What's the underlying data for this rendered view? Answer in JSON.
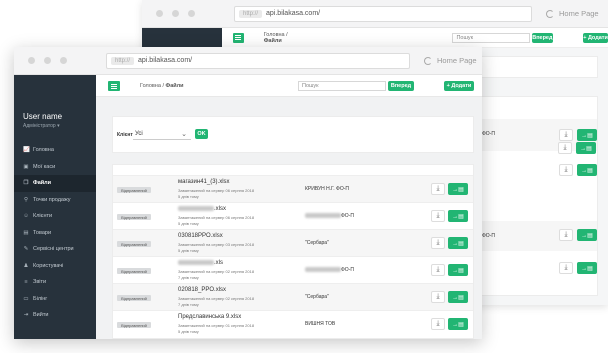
{
  "back_window": {
    "url": "api.bilakasa.com/",
    "url_prefix": "http://",
    "home_label": "Home Page",
    "breadcrumb_home": "Головна",
    "breadcrumb_sep": "/",
    "breadcrumb_current": "Файли",
    "search_placeholder": "Пошук",
    "search_button": "Вперед",
    "add_button": "+ Додати",
    "rows": [
      {
        "client_suffix": "ФО-П"
      },
      {
        "client_suffix": ""
      },
      {
        "client_suffix": "ФО-П"
      },
      {
        "client_suffix": ""
      },
      {
        "client_suffix": ""
      }
    ]
  },
  "front_window": {
    "url_prefix": "http://",
    "url": "api.bilakasa.com/",
    "home_label": "Home Page",
    "user": {
      "name": "User name",
      "role": "Адміністратор ▾"
    },
    "sidebar": {
      "items": [
        {
          "icon": "chart-icon",
          "glyph": "📈",
          "label": "Головна",
          "active": false
        },
        {
          "icon": "cart-icon",
          "glyph": "▣",
          "label": "Мої каси",
          "active": false
        },
        {
          "icon": "files-icon",
          "glyph": "❐",
          "label": "Файли",
          "active": true
        },
        {
          "icon": "map-pin-icon",
          "glyph": "⚲",
          "label": "Точки продажу",
          "active": false
        },
        {
          "icon": "users-icon",
          "glyph": "☺",
          "label": "Клієнти",
          "active": false
        },
        {
          "icon": "box-icon",
          "glyph": "▤",
          "label": "Товари",
          "active": false
        },
        {
          "icon": "wrench-icon",
          "glyph": "✎",
          "label": "Сервісні центри",
          "active": false
        },
        {
          "icon": "user-icon",
          "glyph": "♟",
          "label": "Користувачі",
          "active": false
        },
        {
          "icon": "reports-icon",
          "glyph": "≡",
          "label": "Звіти",
          "active": false
        },
        {
          "icon": "billing-icon",
          "glyph": "▭",
          "label": "Білінг",
          "active": false
        },
        {
          "icon": "logout-icon",
          "glyph": "⇥",
          "label": "Вийти",
          "active": false
        }
      ]
    },
    "header": {
      "breadcrumb_home": "Головна",
      "breadcrumb_sep": "/",
      "breadcrumb_current": "Файли",
      "search_placeholder": "Пошук",
      "search_button": "Вперед",
      "add_button": "+ Додати"
    },
    "filter": {
      "label": "Клієнт",
      "selected": "Усі",
      "ok_button": "OK"
    },
    "files": [
      {
        "status": "Відправлений",
        "name": "магазин41_(3).xlsx",
        "name_blurred": false,
        "uploaded": "Завантажений на сервер 06 серпня 2018",
        "age": "5 днів тому",
        "client": "КРИВУН Н.Г. ФО-П",
        "client_blurred": false
      },
      {
        "status": "Відправлений",
        "name": ".xlsx",
        "name_blurred": true,
        "uploaded": "Завантажений на сервер 06 серпня 2018",
        "age": "5 днів тому",
        "client": "ФО-П",
        "client_blurred": true
      },
      {
        "status": "Відправлений",
        "name": "030818PPO.xlsx",
        "name_blurred": false,
        "uploaded": "Завантажений на сервер 03 серпня 2018",
        "age": "5 днів тому",
        "client": "\"Сербара\"",
        "client_blurred": false
      },
      {
        "status": "Відправлений",
        "name": ".xls",
        "name_blurred": true,
        "uploaded": "Завантажений на сервер 02 серпня 2018",
        "age": "7 днів тому",
        "client": "ФО-П",
        "client_blurred": true
      },
      {
        "status": "Відправлений",
        "name": "020818_PPO.xlsx",
        "name_blurred": false,
        "uploaded": "Завантажений на сервер 02 серпня 2018",
        "age": "7 днів тому",
        "client": "\"Сербара\"",
        "client_blurred": false
      },
      {
        "status": "Відправлений",
        "name": "Предславинська 9.xlsx",
        "name_blurred": false,
        "uploaded": "Завантажений на сервер 01 серпня 2018",
        "age": "5 днів тому",
        "client": "ВИШНЯ ТОВ",
        "client_blurred": false
      }
    ],
    "row_icons": {
      "download": "⤓",
      "send": "→▤"
    }
  }
}
